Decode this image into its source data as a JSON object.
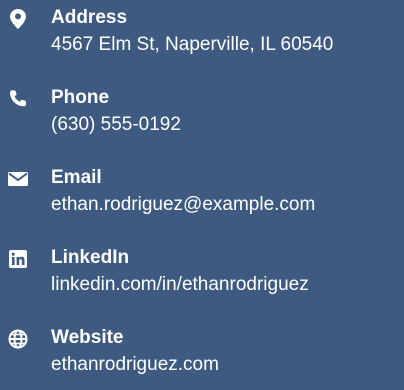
{
  "contacts": [
    {
      "icon": "map-pin-icon",
      "label": "Address",
      "value": "4567 Elm St, Naperville, IL 60540"
    },
    {
      "icon": "phone-icon",
      "label": "Phone",
      "value": "(630) 555-0192"
    },
    {
      "icon": "envelope-icon",
      "label": "Email",
      "value": "ethan.rodriguez@example.com"
    },
    {
      "icon": "linkedin-icon",
      "label": "LinkedIn",
      "value": "linkedin.com/in/ethanrodriguez"
    },
    {
      "icon": "globe-icon",
      "label": "Website",
      "value": "ethanrodriguez.com"
    }
  ],
  "colors": {
    "background": "#3e5a80",
    "text": "#ffffff"
  }
}
